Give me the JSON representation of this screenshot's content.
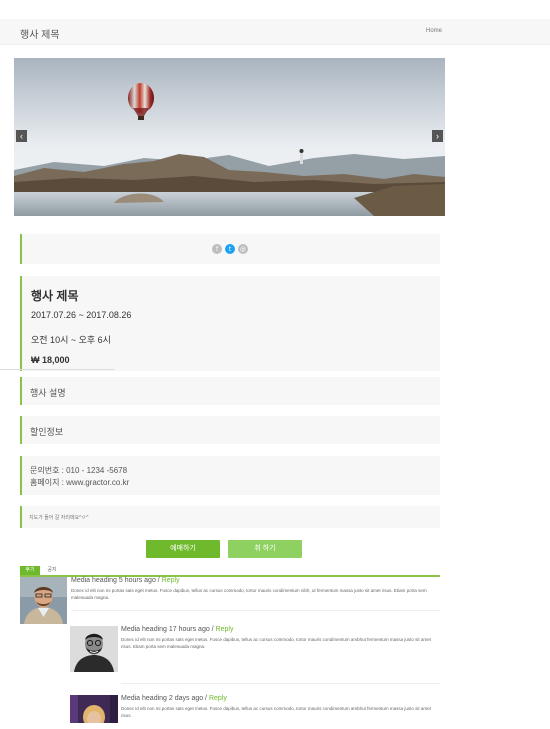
{
  "topbar": {
    "title": "행사 제목",
    "home": "Home"
  },
  "carousel": {
    "prev_icon": "chevron-left-icon",
    "next_icon": "chevron-right-icon",
    "prev_glyph": "‹",
    "next_glyph": "›"
  },
  "share": {
    "icons": [
      "facebook-icon",
      "twitter-icon",
      "mail-icon"
    ],
    "fb_glyph": "f",
    "tw_glyph": "t",
    "ml_glyph": "@"
  },
  "event": {
    "title": "행사 제목",
    "date": "2017.07.26 ~ 2017.08.26",
    "time": "오전 10시 ~ 오후 6시",
    "price": "₩ 18,000"
  },
  "sections": {
    "description": "행사 설명",
    "discount": "할인정보"
  },
  "contact": {
    "phone_line": "문의번호 : 010 - 1234 -5678",
    "homepage_line": "홈페이지 : www.gractor.co.kr"
  },
  "map_note": "지도가 들어 갈 자리에요^ㅇ^",
  "buttons": {
    "book": "예매하기",
    "cancel": "취 하기"
  },
  "tabs": {
    "review": "후기",
    "notice": "공지"
  },
  "comments": [
    {
      "heading": "Media heading 5 hours ago / ",
      "reply": "Reply",
      "body": "Donec id elit non mi portas sats eget metus. Fusce dapibus, tellus ac cursus commodo, tortor mauris condimentum nibh, ut fermentum massa justo sit amet risus. Etiam porta sem malesuada magna."
    },
    {
      "heading": "Media heading 17 hours ago / ",
      "reply": "Reply",
      "body": "Donec id elit non mi portas sats eget metus. Fusce dapibus, tellus ac cursus commodo, tortor mauris condimentum ambhut fermentum massa justo sit amet risus. Etiam porta sem malesuada magna."
    },
    {
      "heading": "Media heading 2 days ago / ",
      "reply": "Reply",
      "body": "Donec id elit non mi portas sats eget metus. Fusce dapibus, tellus ac cursus commodo, tortor mauris condimentum ambhut fermentum massa justo sit amet risus."
    }
  ],
  "colors": {
    "accent": "#6fba2c",
    "accent_light": "#8fd160",
    "panel_bg": "#f7f7f7",
    "twitter": "#1da1f2"
  }
}
